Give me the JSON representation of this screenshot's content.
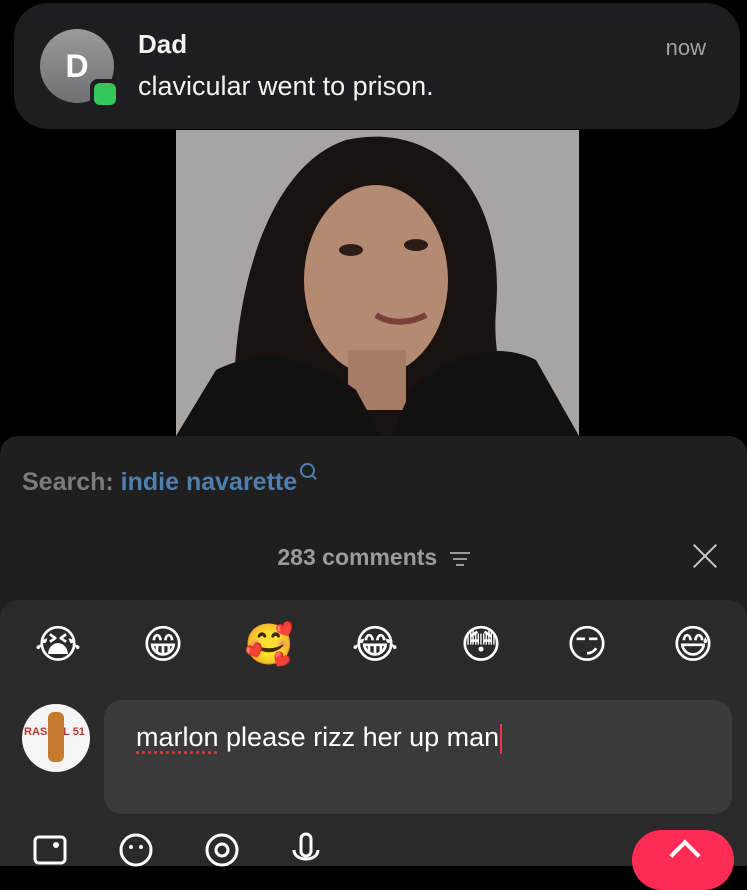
{
  "notification": {
    "avatar_initial": "D",
    "sender": "Dad",
    "message": "clavicular went to prison.",
    "time": "now",
    "app_icon": "messages-icon"
  },
  "video": {
    "description_icon": "video-frame"
  },
  "comments": {
    "search_label": "Search:",
    "search_term": "indie navarette",
    "count_label": "283 comments"
  },
  "composer": {
    "emojis": [
      "😭",
      "😁",
      "🥰",
      "😂",
      "😳",
      "😏",
      "😅"
    ],
    "avatar_text": "RASCAL 51",
    "input_value": "marlon please rizz her up man",
    "input_misspelled": "marlon",
    "input_rest": " please rizz her up man",
    "icons": [
      "image-icon",
      "emoji-icon",
      "mention-icon",
      "microphone-icon"
    ],
    "send_icon": "arrow-up-icon"
  },
  "colors": {
    "accent": "#fe2c55",
    "search_term": "#4f7fb1",
    "sheet_bg": "#1f1f1f"
  }
}
